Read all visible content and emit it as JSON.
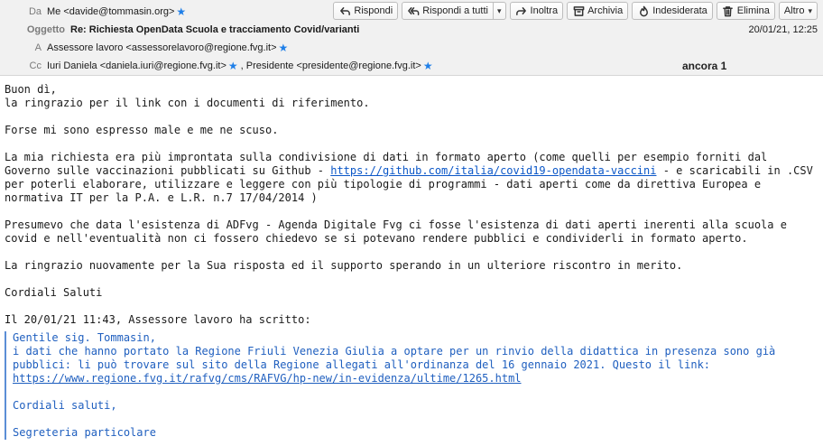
{
  "header": {
    "from": {
      "label": "Da",
      "value": "Me <davide@tommasin.org>"
    },
    "subject": {
      "label": "Oggetto",
      "value": "Re: Richiesta OpenData Scuola e tracciamento Covid/varianti"
    },
    "to": {
      "label": "A",
      "value": "Assessore lavoro <assessorelavoro@regione.fvg.it>"
    },
    "cc": {
      "label": "Cc",
      "value1": "Iuri Daniela <daniela.iuri@regione.fvg.it>",
      "value2": "Presidente <presidente@regione.fvg.it>"
    },
    "date": "20/01/21, 12:25",
    "tag": "ancora 1"
  },
  "toolbar": {
    "reply": "Rispondi",
    "reply_all": "Rispondi a tutti",
    "forward": "Inoltra",
    "archive": "Archivia",
    "junk": "Indesiderata",
    "delete": "Elimina",
    "more": "Altro"
  },
  "body": {
    "p1": "Buon dì,\nla ringrazio per il link con i documenti di riferimento.",
    "p2": "Forse mi sono espresso male e me ne scuso.",
    "p3_a": "La mia richiesta era più improntata sulla condivisione di dati in formato aperto (come quelli per esempio forniti dal\nGoverno sulle vaccinazioni pubblicati su Github - ",
    "p3_link": "https://github.com/italia/covid19-opendata-vaccini",
    "p3_b": " - e scaricabili in .CSV\nper poterli elaborare, utilizzare e leggere con più tipologie di programmi - dati aperti come da direttiva Europea e\nnormativa IT per la P.A. e L.R. n.7 17/04/2014 )",
    "p4": "Presumevo che data l'esistenza di ADFvg - Agenda Digitale Fvg ci fosse l'esistenza di dati aperti inerenti alla scuola e\ncovid e nell'eventualità non ci fossero chiedevo se si potevano rendere pubblici e condividerli in formato aperto.",
    "p5": "La ringrazio nuovamente per la Sua risposta ed il supporto sperando in un ulteriore riscontro in merito.",
    "p6": "Cordiali Saluti",
    "quote_intro": "Il 20/01/21 11:43, Assessore lavoro ha scritto:",
    "quote": {
      "l1": "Gentile sig. Tommasin,",
      "l2": "i dati che hanno portato la Regione Friuli Venezia Giulia a optare per un rinvio della didattica in presenza sono già\npubblici: li può trovare sul sito della Regione allegati all'ordinanza del 16 gennaio 2021. Questo il link:",
      "link": "https://www.regione.fvg.it/rafvg/cms/RAFVG/hp-new/in-evidenza/ultime/1265.html",
      "l3": "Cordiali saluti,",
      "l4": "Segreteria particolare"
    }
  }
}
